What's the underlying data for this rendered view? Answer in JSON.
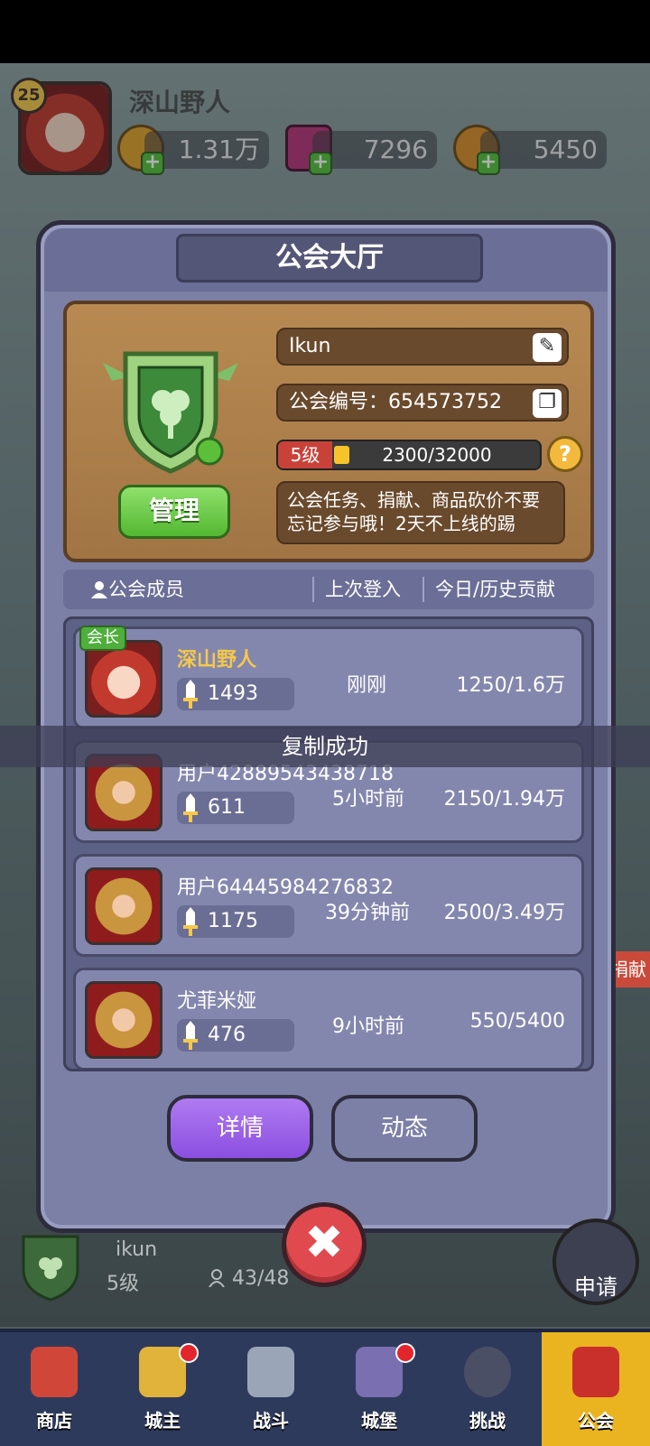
{
  "player": {
    "level": "25",
    "name": "深山野人",
    "resources": [
      {
        "icon": "gold-coin-icon",
        "amount": "1.31万"
      },
      {
        "icon": "gem-icon",
        "amount": "7296"
      },
      {
        "icon": "token-coin-icon",
        "amount": "5450"
      }
    ]
  },
  "modal": {
    "title": "公会大厅",
    "guild": {
      "name": "Ikun",
      "id_label": "公会编号：654573752",
      "level": "5级",
      "exp_text": "2300/32000",
      "exp_fraction": 0.072,
      "notice": "公会任务、捐献、商品砍价不要忘记参与哦！2天不上线的踢",
      "manage_label": "管理",
      "help": "?"
    },
    "columns": {
      "members": "公会成员（43/48）",
      "last_login": "上次登入",
      "contribution": "今日/历史贡献"
    },
    "members": [
      {
        "name": "深山野人",
        "power": "1493",
        "last_login": "刚刚",
        "contribution": "1250/1.6万",
        "leader": true,
        "leader_label": "会长"
      },
      {
        "name": "用户42889543438718",
        "power": "611",
        "last_login": "5小时前",
        "contribution": "2150/1.94万"
      },
      {
        "name": "用户64445984276832",
        "power": "1175",
        "last_login": "39分钟前",
        "contribution": "2500/3.49万"
      },
      {
        "name": "尤菲米娅",
        "power": "476",
        "last_login": "9小时前",
        "contribution": "550/5400"
      }
    ],
    "toast": "复制成功",
    "buttons": {
      "details": "详情",
      "activity": "动态"
    },
    "close": "✖"
  },
  "guild_strip": {
    "name": "ikun",
    "level": "5级",
    "count": "43/48",
    "apply": "申请",
    "donate": "捐献"
  },
  "nav": [
    {
      "label": "商店",
      "badge": false
    },
    {
      "label": "城主",
      "badge": true
    },
    {
      "label": "战斗",
      "badge": false
    },
    {
      "label": "城堡",
      "badge": true
    },
    {
      "label": "挑战",
      "badge": false
    },
    {
      "label": "公会",
      "badge": false,
      "active": true
    }
  ],
  "colors": {
    "modal_bg": "#7c7fa6",
    "card_bg": "#b88a52",
    "primary_button": "#8b4fe0",
    "leader_name": "#f5c84a",
    "close_button": "#e04a4f",
    "manage_button": "#53b832"
  }
}
